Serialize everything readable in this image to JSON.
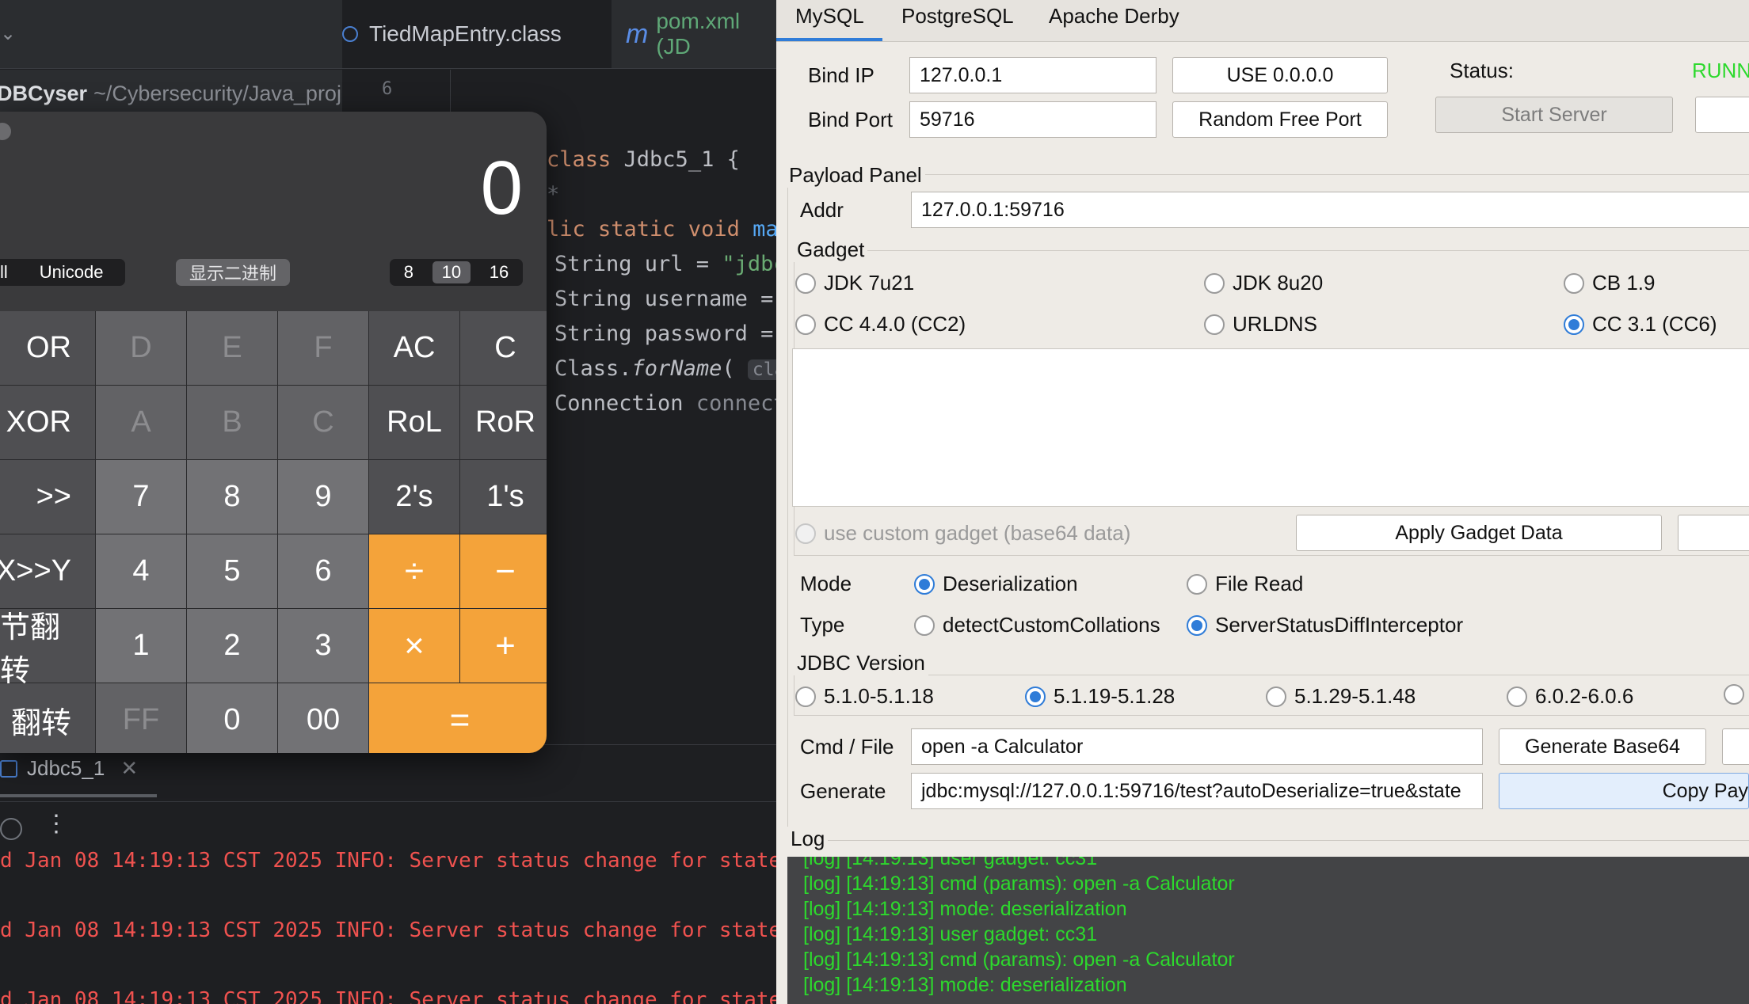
{
  "ide": {
    "tabs": [
      {
        "label": "TiedMapEntry.class"
      },
      {
        "label": "pom.xml (JD"
      }
    ],
    "pom_icon": "m",
    "project": {
      "name": "DBCyser",
      "path": "~/Cybersecurity/Java_proj"
    },
    "gutter_line": "6",
    "code": {
      "l1_kw": "class",
      "l1_rest": " Jdbc5_1 {",
      "l2": "*",
      "l3_kw": "lic static void",
      "l3_fn": " mai",
      "l4_a": "String url = ",
      "l4_str": "\"jdbc",
      "l5": "String username =",
      "l6": "String password =",
      "l7_a": "Class.",
      "l7_fn": "forName",
      "l7_b": "(",
      "l7_hint": "class",
      "l8_a": "Connection ",
      "l8_hint": "connect"
    },
    "bottom_tab": "Jdbc5_1",
    "console": [
      "d Jan 08 14:19:13 CST 2025 INFO: Server status change for state",
      "d Jan 08 14:19:13 CST 2025 INFO: Server status change for state",
      "d Jan 08 14:19:13 CST 2025 INFO: Server status change for state"
    ]
  },
  "calculator": {
    "display": "0",
    "encodings": [
      "ll",
      "Unicode"
    ],
    "show_binary": "显示二进制",
    "bases": [
      "8",
      "10",
      "16"
    ],
    "selected_base": "10",
    "keys": [
      [
        "OR",
        "D",
        "E",
        "F",
        "AC",
        "C"
      ],
      [
        "XOR",
        "A",
        "B",
        "C",
        "RoL",
        "RoR"
      ],
      [
        ">>",
        "7",
        "8",
        "9",
        "2's",
        "1's"
      ],
      [
        "X>>Y",
        "4",
        "5",
        "6",
        "÷",
        "−"
      ],
      [
        "节翻转",
        "1",
        "2",
        "3",
        "×",
        "+"
      ],
      [
        "翻转",
        "FF",
        "0",
        "00",
        "="
      ]
    ]
  },
  "tool": {
    "tabs": [
      "MySQL",
      "PostgreSQL",
      "Apache Derby"
    ],
    "bind_ip_label": "Bind IP",
    "bind_ip": "127.0.0.1",
    "use_all_button": "USE 0.0.0.0",
    "bind_port_label": "Bind Port",
    "bind_port": "59716",
    "random_port_button": "Random Free Port",
    "status_label": "Status:",
    "status_value": "RUNN",
    "start_server_button": "Start Server",
    "payload_panel": "Payload Panel",
    "addr_label": "Addr",
    "addr": "127.0.0.1:59716",
    "gadget_title": "Gadget",
    "gadgets": [
      "JDK 7u21",
      "JDK 8u20",
      "CB 1.9",
      "CC 4.4.0 (CC2)",
      "URLDNS",
      "CC 3.1 (CC6)"
    ],
    "selected_gadget": "CC 3.1 (CC6)",
    "custom_gadget": "use custom gadget (base64 data)",
    "apply_gadget_button": "Apply Gadget Data",
    "mode_label": "Mode",
    "modes": [
      "Deserialization",
      "File Read"
    ],
    "selected_mode": "Deserialization",
    "type_label": "Type",
    "types": [
      "detectCustomCollations",
      "ServerStatusDiffInterceptor"
    ],
    "selected_type": "ServerStatusDiffInterceptor",
    "jdbc_title": "JDBC Version",
    "jdbc_versions": [
      "5.1.0-5.1.18",
      "5.1.19-5.1.28",
      "5.1.29-5.1.48",
      "6.0.2-6.0.6"
    ],
    "selected_jdbc": "5.1.19-5.1.28",
    "cmd_label": "Cmd / File",
    "cmd": "open -a Calculator",
    "gen_base64_button": "Generate Base64",
    "generate_label": "Generate",
    "generate_value": "jdbc:mysql://127.0.0.1:59716/test?autoDeserialize=true&state",
    "copy_button": "Copy Pay",
    "log_title": "Log",
    "log": [
      "[log] [14:19:13] user gadget: cc31",
      "[log] [14:19:13] cmd (params): open -a Calculator",
      "[log] [14:19:13] mode: deserialization",
      "[log] [14:19:13] user gadget: cc31",
      "[log] [14:19:13] cmd (params): open -a Calculator",
      "[log] [14:19:13] mode: deserialization"
    ],
    "colors": {
      "accent": "#2f7cd8",
      "status": "#2dd92d",
      "log_text": "#2dd92d"
    }
  }
}
